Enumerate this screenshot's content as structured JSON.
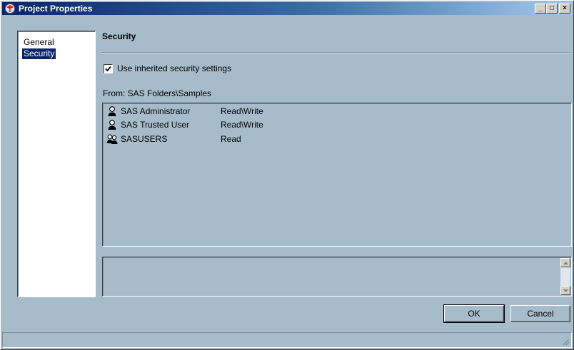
{
  "window": {
    "title": "Project Properties",
    "minimize_label": "_",
    "maximize_label": "□",
    "close_label": "×"
  },
  "nav": {
    "items": [
      {
        "label": "General",
        "selected": false
      },
      {
        "label": "Security",
        "selected": true
      }
    ]
  },
  "security": {
    "section_title": "Security",
    "inherit_checkbox": {
      "label": "Use inherited security settings",
      "checked": true
    },
    "from_label": "From: SAS Folders\\Samples",
    "entries": [
      {
        "icon": "user-icon",
        "name": "SAS Administrator",
        "permission": "Read\\Write"
      },
      {
        "icon": "user-icon",
        "name": "SAS Trusted User",
        "permission": "Read\\Write"
      },
      {
        "icon": "group-icon",
        "name": "SASUSERS",
        "permission": "Read"
      }
    ],
    "description_text": ""
  },
  "buttons": {
    "ok_label": "OK",
    "cancel_label": "Cancel"
  },
  "colors": {
    "background": "#a6bccb",
    "title_bar_start": "#0a246a",
    "selection": "#0a246a"
  }
}
